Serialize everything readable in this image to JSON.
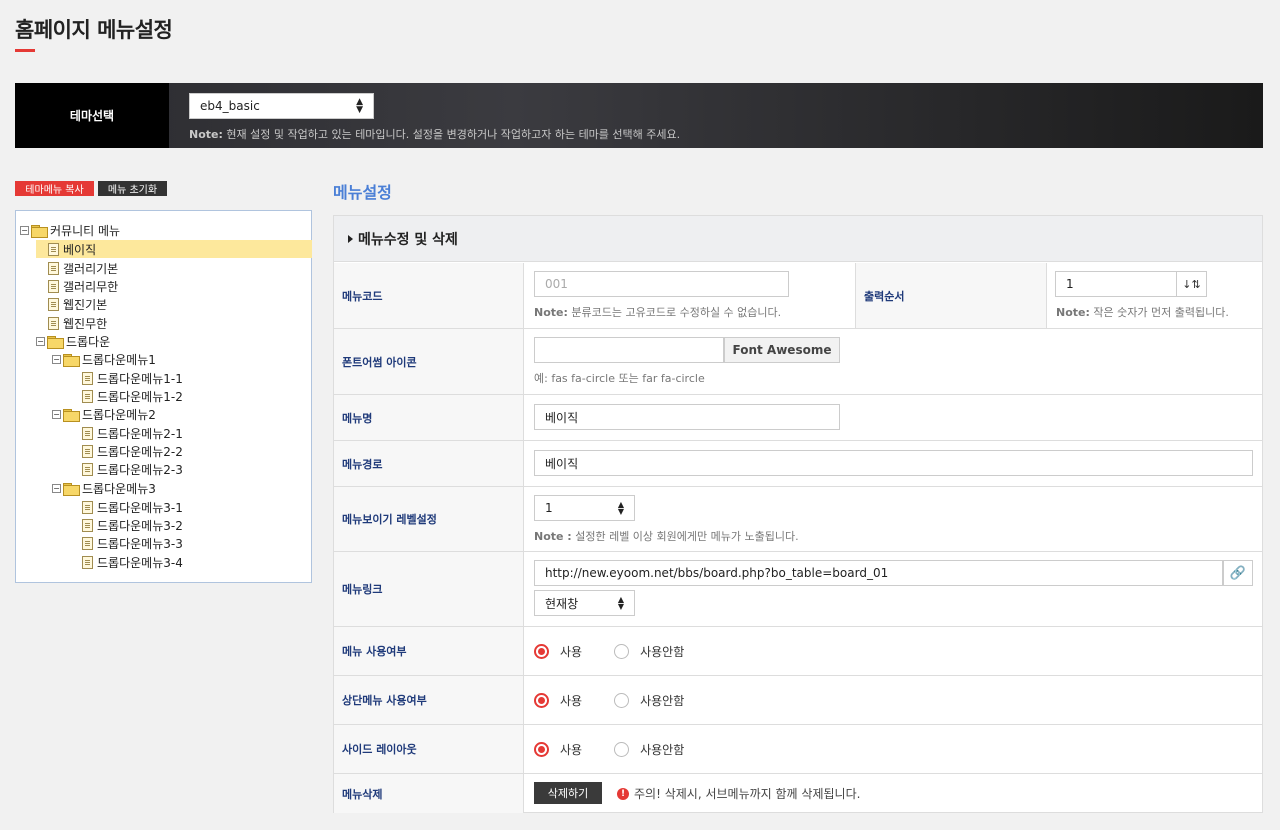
{
  "page": {
    "title": "홈페이지 메뉴설정"
  },
  "theme": {
    "label": "테마선택",
    "selected": "eb4_basic",
    "note_prefix": "Note:",
    "note_text": " 현재 설정 및 작업하고 있는 테마입니다. 설정을 변경하거나 작업하고자 하는 테마를 선택해 주세요."
  },
  "actions": {
    "copy_label": "테마메뉴 복사",
    "reset_label": "메뉴 초기화"
  },
  "tree": {
    "root": "커뮤니티 메뉴",
    "items": [
      "베이직",
      "갤러리기본",
      "갤러리무한",
      "웹진기본",
      "웹진무한"
    ],
    "dropdown": "드롭다운",
    "sub1": "드롭다운메뉴1",
    "sub1_items": [
      "드롭다운메뉴1-1",
      "드롭다운메뉴1-2"
    ],
    "sub2": "드롭다운메뉴2",
    "sub2_items": [
      "드롭다운메뉴2-1",
      "드롭다운메뉴2-2",
      "드롭다운메뉴2-3"
    ],
    "sub3": "드롭다운메뉴3",
    "sub3_items": [
      "드롭다운메뉴3-1",
      "드롭다운메뉴3-2",
      "드롭다운메뉴3-3",
      "드롭다운메뉴3-4"
    ]
  },
  "section": {
    "title": "메뉴설정"
  },
  "panel": {
    "header": "메뉴수정 및 삭제",
    "menu_code_label": "메뉴코드",
    "menu_code_placeholder": "001",
    "menu_code_note_prefix": "Note:",
    "menu_code_note": " 분류코드는 고유코드로 수정하실 수 없습니다.",
    "order_label": "출력순서",
    "order_value": "1",
    "order_note_prefix": "Note:",
    "order_note": " 작은 숫자가 먼저 출력됩니다.",
    "icon_label": "폰트어썸 아이콘",
    "icon_button": "Font Awesome",
    "icon_hint": "예: fas fa-circle 또는 far fa-circle",
    "name_label": "메뉴명",
    "name_value": "베이직",
    "path_label": "메뉴경로",
    "path_value": "베이직",
    "level_label": "메뉴보이기 레벨설정",
    "level_value": "1",
    "level_note_prefix": "Note :",
    "level_note": " 설정한 레벨 이상 회원에게만 메뉴가 노출됩니다.",
    "link_label": "메뉴링크",
    "link_value": "http://new.eyoom.net/bbs/board.php?bo_table=board_01",
    "target_value": "현재창",
    "use_label": "메뉴 사용여부",
    "top_use_label": "상단메뉴 사용여부",
    "side_label": "사이드 레이아웃",
    "opt_yes": "사용",
    "opt_no": "사용안함",
    "delete_label": "메뉴삭제",
    "delete_button": "삭제하기",
    "delete_warning": "주의! 삭제시, 서브메뉴까지 함께 삭제됩니다."
  },
  "colors": {
    "accent": "#e53935",
    "link_blue": "#4a7fd6",
    "label_navy": "#1f3a7a"
  }
}
